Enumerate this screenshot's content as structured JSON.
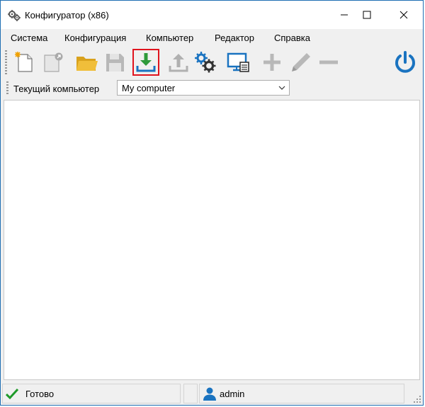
{
  "window": {
    "title": "Конфигуратор (x86)",
    "border_color": "#1f6fb3"
  },
  "titlebar_buttons": {
    "minimize": "minimize-icon",
    "maximize": "maximize-icon",
    "close": "close-icon"
  },
  "menu": {
    "items": [
      "Система",
      "Конфигурация",
      "Компьютер",
      "Редактор",
      "Справка"
    ]
  },
  "toolbar": {
    "tools": [
      {
        "icon": "new-document-icon"
      },
      {
        "icon": "open-link-document-icon"
      },
      {
        "icon": "folder-icon"
      },
      {
        "icon": "save-disk-icon",
        "disabled": true
      },
      {
        "icon": "download-icon",
        "highlighted": true
      },
      {
        "icon": "upload-icon",
        "disabled": true
      },
      {
        "icon": "gears-icon"
      },
      {
        "icon": "computer-screen-icon"
      },
      {
        "icon": "plus-icon",
        "disabled": true
      },
      {
        "icon": "pencil-icon",
        "disabled": true
      },
      {
        "icon": "minus-icon",
        "disabled": true
      },
      {
        "icon": "power-icon"
      }
    ],
    "highlight_color": "#e0141e",
    "accent_color": "#1a73c0"
  },
  "computer_selector": {
    "label": "Текущий компьютер",
    "value": "My computer"
  },
  "status": {
    "state_text": "Готово",
    "user_text": "admin",
    "ok_color": "#1f9a2a"
  }
}
